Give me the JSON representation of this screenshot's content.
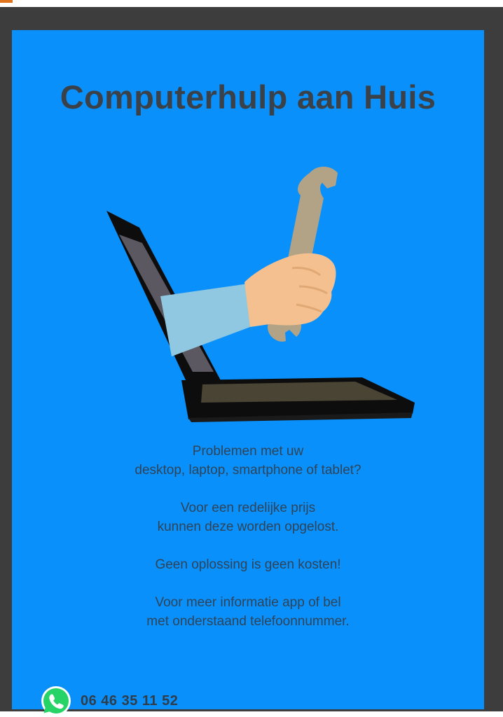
{
  "poster": {
    "title": "Computerhulp aan Huis",
    "illustration": "laptop-with-hand-holding-wrench",
    "paragraphs": [
      {
        "lines": [
          "Problemen met uw",
          "desktop, laptop, smartphone of tablet?"
        ]
      },
      {
        "lines": [
          "Voor een redelijke prijs",
          "kunnen deze worden opgelost."
        ]
      },
      {
        "lines": [
          "Geen oplossing is geen kosten!"
        ]
      },
      {
        "lines": [
          "Voor meer informatie app of bel",
          "met onderstaand telefoonnummer."
        ]
      }
    ],
    "contact": {
      "icon": "whatsapp-icon",
      "phone": "06 46 35 11 52"
    }
  },
  "colors": {
    "frame": "#3d3d3d",
    "background": "#0a90fb",
    "title": "#3a4149",
    "text": "#2f4458",
    "whatsapp": "#25d366"
  }
}
